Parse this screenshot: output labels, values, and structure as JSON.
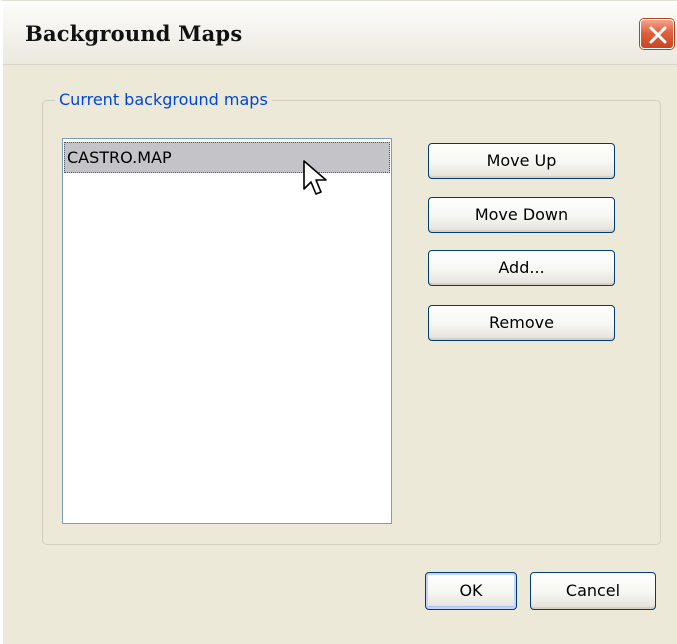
{
  "window": {
    "title": "Background Maps"
  },
  "group": {
    "legend": "Current background maps"
  },
  "list": {
    "items": [
      {
        "label": "CASTRO.MAP",
        "selected": true
      }
    ]
  },
  "buttons": {
    "move_up": "Move Up",
    "move_down": "Move Down",
    "add": "Add...",
    "remove": "Remove",
    "ok": "OK",
    "cancel": "Cancel"
  },
  "icons": {
    "close": "close-icon",
    "cursor": "mouse-pointer-icon"
  },
  "colors": {
    "dialog_bg": "#ece9d8",
    "legend_text": "#0046d5",
    "selection_bg": "#c4c4c8",
    "close_button": "#e0603d"
  }
}
